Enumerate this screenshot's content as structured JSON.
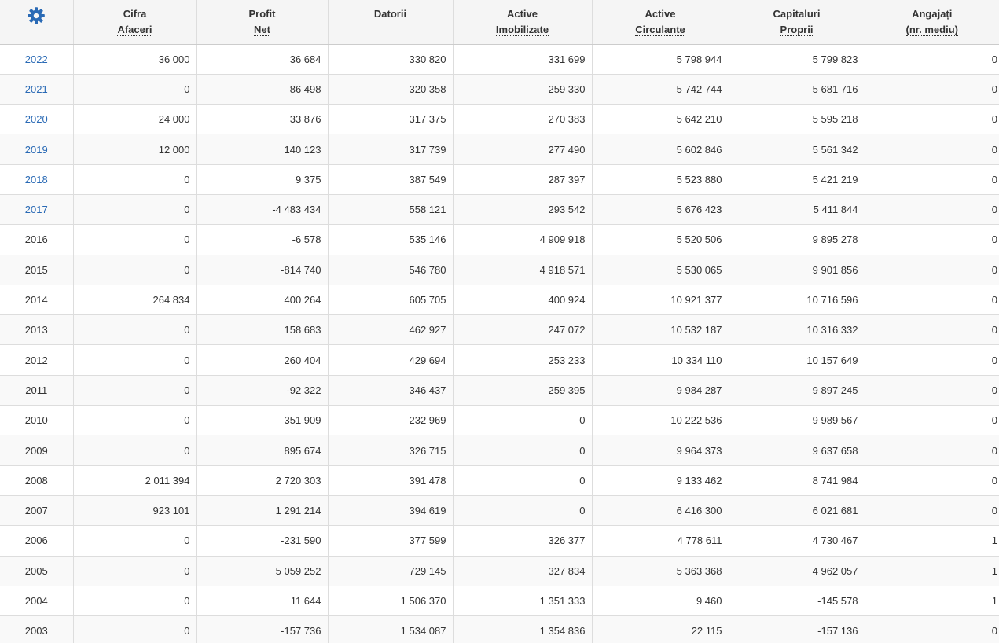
{
  "colors": {
    "link": "#2a6ab5",
    "gear": "#2a6ab5",
    "header_bg": "#f5f5f5",
    "text": "#333333"
  },
  "header": {
    "settings_icon": "gear-icon",
    "columns": [
      {
        "line1": "Cifra",
        "line2": "Afaceri"
      },
      {
        "line1": "Profit",
        "line2": "Net"
      },
      {
        "line1": "Datorii",
        "line2": ""
      },
      {
        "line1": "Active",
        "line2": "Imobilizate"
      },
      {
        "line1": "Active",
        "line2": "Circulante"
      },
      {
        "line1": "Capitaluri",
        "line2": "Proprii"
      },
      {
        "line1": "Angajați",
        "line2": "(nr. mediu)"
      }
    ]
  },
  "rows": [
    {
      "year": "2022",
      "link": true,
      "cells": [
        "36 000",
        "36 684",
        "330 820",
        "331 699",
        "5 798 944",
        "5 799 823",
        "0"
      ]
    },
    {
      "year": "2021",
      "link": true,
      "cells": [
        "0",
        "86 498",
        "320 358",
        "259 330",
        "5 742 744",
        "5 681 716",
        "0"
      ]
    },
    {
      "year": "2020",
      "link": true,
      "cells": [
        "24 000",
        "33 876",
        "317 375",
        "270 383",
        "5 642 210",
        "5 595 218",
        "0"
      ]
    },
    {
      "year": "2019",
      "link": true,
      "cells": [
        "12 000",
        "140 123",
        "317 739",
        "277 490",
        "5 602 846",
        "5 561 342",
        "0"
      ]
    },
    {
      "year": "2018",
      "link": true,
      "cells": [
        "0",
        "9 375",
        "387 549",
        "287 397",
        "5 523 880",
        "5 421 219",
        "0"
      ]
    },
    {
      "year": "2017",
      "link": true,
      "cells": [
        "0",
        "-4 483 434",
        "558 121",
        "293 542",
        "5 676 423",
        "5 411 844",
        "0"
      ]
    },
    {
      "year": "2016",
      "link": false,
      "cells": [
        "0",
        "-6 578",
        "535 146",
        "4 909 918",
        "5 520 506",
        "9 895 278",
        "0"
      ]
    },
    {
      "year": "2015",
      "link": false,
      "cells": [
        "0",
        "-814 740",
        "546 780",
        "4 918 571",
        "5 530 065",
        "9 901 856",
        "0"
      ]
    },
    {
      "year": "2014",
      "link": false,
      "cells": [
        "264 834",
        "400 264",
        "605 705",
        "400 924",
        "10 921 377",
        "10 716 596",
        "0"
      ]
    },
    {
      "year": "2013",
      "link": false,
      "cells": [
        "0",
        "158 683",
        "462 927",
        "247 072",
        "10 532 187",
        "10 316 332",
        "0"
      ]
    },
    {
      "year": "2012",
      "link": false,
      "cells": [
        "0",
        "260 404",
        "429 694",
        "253 233",
        "10 334 110",
        "10 157 649",
        "0"
      ]
    },
    {
      "year": "2011",
      "link": false,
      "cells": [
        "0",
        "-92 322",
        "346 437",
        "259 395",
        "9 984 287",
        "9 897 245",
        "0"
      ]
    },
    {
      "year": "2010",
      "link": false,
      "cells": [
        "0",
        "351 909",
        "232 969",
        "0",
        "10 222 536",
        "9 989 567",
        "0"
      ]
    },
    {
      "year": "2009",
      "link": false,
      "cells": [
        "0",
        "895 674",
        "326 715",
        "0",
        "9 964 373",
        "9 637 658",
        "0"
      ]
    },
    {
      "year": "2008",
      "link": false,
      "cells": [
        "2 011 394",
        "2 720 303",
        "391 478",
        "0",
        "9 133 462",
        "8 741 984",
        "0"
      ]
    },
    {
      "year": "2007",
      "link": false,
      "cells": [
        "923 101",
        "1 291 214",
        "394 619",
        "0",
        "6 416 300",
        "6 021 681",
        "0"
      ]
    },
    {
      "year": "2006",
      "link": false,
      "cells": [
        "0",
        "-231 590",
        "377 599",
        "326 377",
        "4 778 611",
        "4 730 467",
        "1"
      ]
    },
    {
      "year": "2005",
      "link": false,
      "cells": [
        "0",
        "5 059 252",
        "729 145",
        "327 834",
        "5 363 368",
        "4 962 057",
        "1"
      ]
    },
    {
      "year": "2004",
      "link": false,
      "cells": [
        "0",
        "11 644",
        "1 506 370",
        "1 351 333",
        "9 460",
        "-145 578",
        "1"
      ]
    },
    {
      "year": "2003",
      "link": false,
      "cells": [
        "0",
        "-157 736",
        "1 534 087",
        "1 354 836",
        "22 115",
        "-157 136",
        "0"
      ]
    }
  ]
}
